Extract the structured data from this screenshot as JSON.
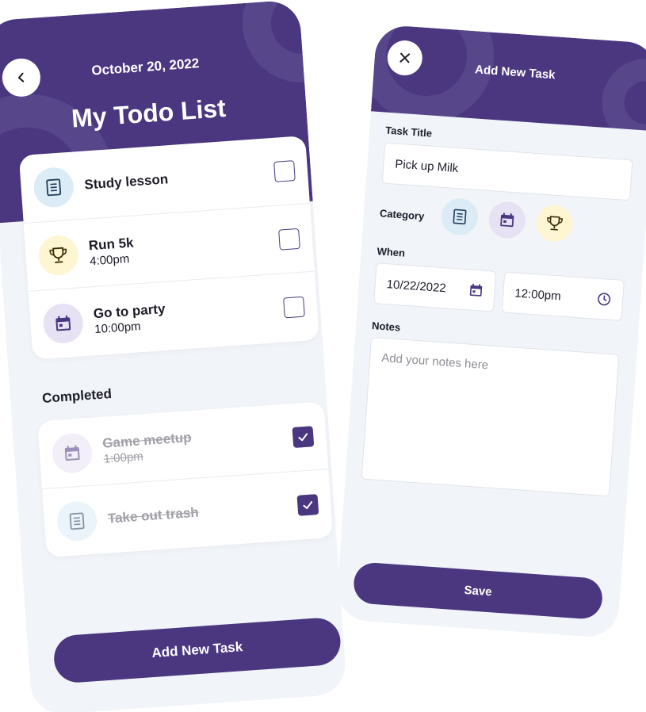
{
  "list_screen": {
    "date": "October 20, 2022",
    "title": "My Todo List",
    "tasks": [
      {
        "title": "Study lesson",
        "time": "",
        "icon": "document-icon",
        "done": false
      },
      {
        "title": "Run 5k",
        "time": "4:00pm",
        "icon": "trophy-icon",
        "done": false
      },
      {
        "title": "Go to party",
        "time": "10:00pm",
        "icon": "calendar-icon",
        "done": false
      }
    ],
    "completed_label": "Completed",
    "completed": [
      {
        "title": "Game meetup",
        "time": "1:00pm",
        "icon": "calendar-icon",
        "done": true
      },
      {
        "title": "Take out trash",
        "time": "",
        "icon": "document-icon",
        "done": true
      }
    ],
    "add_button_label": "Add New Task"
  },
  "add_screen": {
    "title": "Add New Task",
    "task_title_label": "Task Title",
    "task_title_value": "Pick up Milk",
    "category_label": "Category",
    "categories": [
      "document-icon",
      "calendar-icon",
      "trophy-icon"
    ],
    "when_label": "When",
    "date_value": "10/22/2022",
    "time_value": "12:00pm",
    "notes_label": "Notes",
    "notes_placeholder": "Add your notes here",
    "save_label": "Save"
  },
  "colors": {
    "primary": "#4a3780",
    "background": "#f1f4f9",
    "lesson_badge": "#dbecf6",
    "trophy_badge": "#fef5d3",
    "event_badge": "#e7e2f3"
  }
}
